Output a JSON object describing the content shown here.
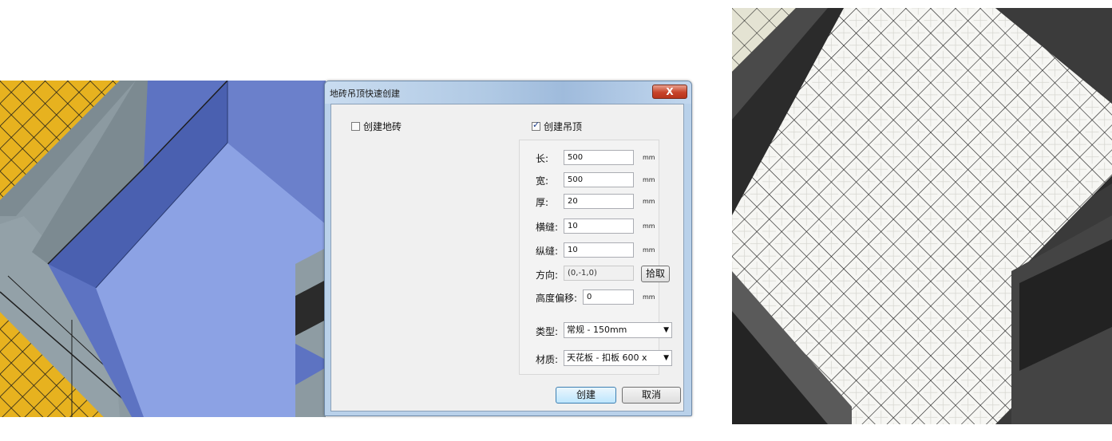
{
  "dialog": {
    "title": "地砖吊顶快速创建",
    "close_label": "X",
    "create_floor_label": "创建地砖",
    "create_floor_checked": false,
    "create_ceiling_label": "创建吊顶",
    "create_ceiling_checked": true,
    "fields": {
      "length": {
        "label": "长:",
        "value": "500",
        "unit": "mm"
      },
      "width": {
        "label": "宽:",
        "value": "500",
        "unit": "mm"
      },
      "thickness": {
        "label": "厚:",
        "value": "20",
        "unit": "mm"
      },
      "h_gap": {
        "label": "横缝:",
        "value": "10",
        "unit": "mm"
      },
      "v_gap": {
        "label": "纵缝:",
        "value": "10",
        "unit": "mm"
      },
      "direction": {
        "label": "方向:",
        "value": "(0,-1,0)",
        "button": "拾取"
      },
      "offset": {
        "label": "高度偏移:",
        "value": "0",
        "unit": "mm"
      },
      "type": {
        "label": "类型:",
        "value": "常规 - 150mm"
      },
      "material": {
        "label": "材质:",
        "value": "天花板 - 扣板 600 x"
      }
    },
    "create_button": "创建",
    "cancel_button": "取消"
  },
  "colors": {
    "tile_yellow": "#e7b21f",
    "room_blue": "#8ea3e3",
    "wall_gray": "#8c9aa1",
    "ceiling_white": "#f6f6f3",
    "dark_wall": "#2f2f2f"
  }
}
